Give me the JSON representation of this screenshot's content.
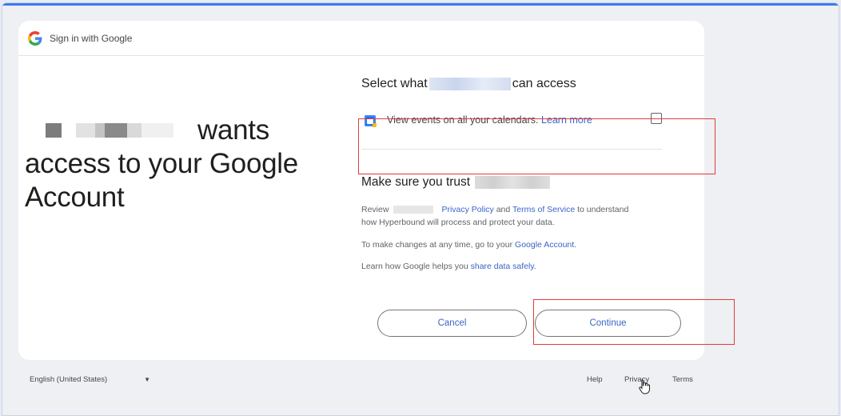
{
  "header": {
    "title": "Sign in with Google"
  },
  "headline": {
    "wants": "wants",
    "line2": "access to your Google",
    "line3": "Account"
  },
  "consent": {
    "select_prefix": "Select what",
    "select_suffix": "can access",
    "permission_text": "View events on all your calendars.",
    "learn_more": "Learn more",
    "trust_prefix": "Make sure you trust",
    "review_prefix": "Review",
    "privacy_policy": "Privacy Policy",
    "and": "and",
    "terms_of_service": "Terms of Service",
    "review_suffix": "to understand how Hyperbound will process and protect your data.",
    "changes_prefix": "To make changes at any time, go to your",
    "google_account": "Google Account",
    "changes_suffix": ".",
    "learn_prefix": "Learn how Google helps you",
    "share_data_safely": "share data safely",
    "learn_suffix": "."
  },
  "buttons": {
    "cancel": "Cancel",
    "continue": "Continue"
  },
  "footer": {
    "language": "English (United States)",
    "help": "Help",
    "privacy": "Privacy",
    "terms": "Terms"
  },
  "colors": {
    "link": "#3b64c8",
    "highlight": "#e33b3b",
    "accent_bar": "#3b7be8"
  }
}
